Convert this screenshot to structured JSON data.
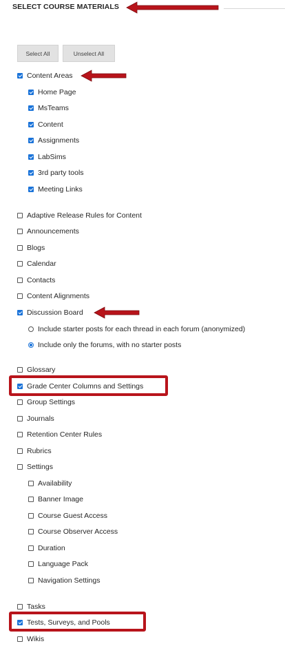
{
  "header": {
    "title": "SELECT COURSE MATERIALS"
  },
  "buttons": {
    "select_all": "Select All",
    "unselect_all": "Unselect All"
  },
  "content_areas": {
    "label": "Content Areas",
    "checked": true,
    "children": [
      {
        "label": "Home Page",
        "checked": true
      },
      {
        "label": "MsTeams",
        "checked": true
      },
      {
        "label": "Content",
        "checked": true
      },
      {
        "label": "Assignments",
        "checked": true
      },
      {
        "label": "LabSims",
        "checked": true
      },
      {
        "label": "3rd party tools",
        "checked": true
      },
      {
        "label": "Meeting Links",
        "checked": true
      }
    ]
  },
  "options": [
    {
      "label": "Adaptive Release Rules for Content",
      "checked": false
    },
    {
      "label": "Announcements",
      "checked": false
    },
    {
      "label": "Blogs",
      "checked": false
    },
    {
      "label": "Calendar",
      "checked": false
    },
    {
      "label": "Contacts",
      "checked": false
    },
    {
      "label": "Content Alignments",
      "checked": false
    },
    {
      "label": "Discussion Board",
      "checked": true
    }
  ],
  "discussion_options": [
    {
      "label": "Include starter posts for each thread in each forum (anonymized)",
      "selected": false
    },
    {
      "label": "Include only the forums, with no starter posts",
      "selected": true
    }
  ],
  "options2": [
    {
      "label": "Glossary",
      "checked": false
    },
    {
      "label": "Grade Center Columns and Settings",
      "checked": true
    },
    {
      "label": "Group Settings",
      "checked": false
    },
    {
      "label": "Journals",
      "checked": false
    },
    {
      "label": "Retention Center Rules",
      "checked": false
    },
    {
      "label": "Rubrics",
      "checked": false
    },
    {
      "label": "Settings",
      "checked": false
    }
  ],
  "settings_children": [
    {
      "label": "Availability",
      "checked": false
    },
    {
      "label": "Banner Image",
      "checked": false
    },
    {
      "label": "Course Guest Access",
      "checked": false
    },
    {
      "label": "Course Observer Access",
      "checked": false
    },
    {
      "label": "Duration",
      "checked": false
    },
    {
      "label": "Language Pack",
      "checked": false
    },
    {
      "label": "Navigation Settings",
      "checked": false
    }
  ],
  "options3": [
    {
      "label": "Tasks",
      "checked": false
    },
    {
      "label": "Tests, Surveys, and Pools",
      "checked": true
    },
    {
      "label": "Wikis",
      "checked": false
    }
  ],
  "colors": {
    "checkbox_checked": "#1a73d9",
    "annotation_red": "#b8141b"
  }
}
